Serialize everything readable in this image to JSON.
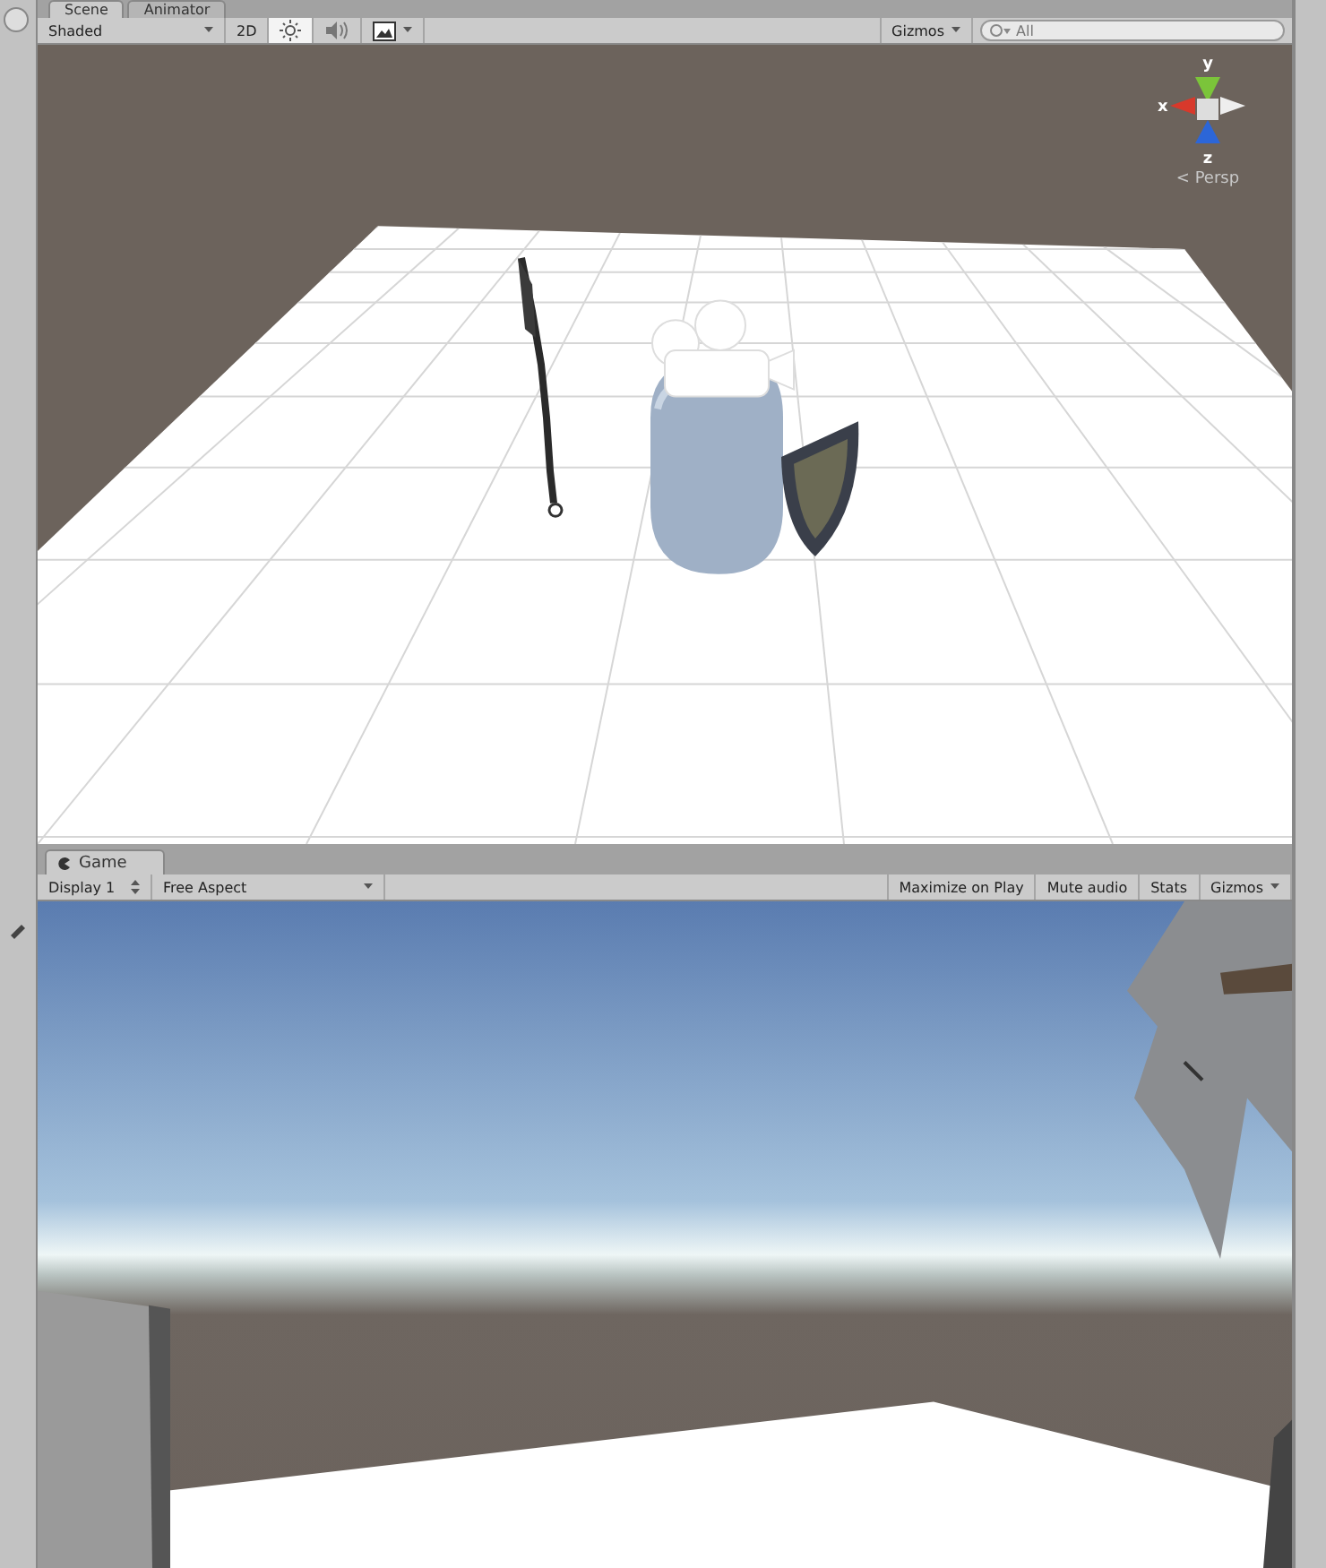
{
  "scene_panel": {
    "tabs": [
      {
        "label": "Scene",
        "selected": true
      },
      {
        "label": "Animator",
        "selected": false
      }
    ],
    "toolbar": {
      "draw_mode": "Shaded",
      "toggles": [
        {
          "kind": "text",
          "label": "2D",
          "on": false
        },
        {
          "kind": "lighting",
          "on": true
        },
        {
          "kind": "audio",
          "on": false
        },
        {
          "kind": "effects",
          "on": false
        }
      ],
      "gizmos": "Gizmos",
      "search": {
        "placeholder": "All"
      }
    },
    "orientation_gizmo": {
      "x_label": "x",
      "y_label": "y",
      "z_label": "z",
      "projection": "< Persp"
    }
  },
  "game_panel": {
    "tab": {
      "label": "Game"
    },
    "toolbar": {
      "display": "Display 1",
      "aspect": "Free Aspect",
      "toggles": [
        {
          "label": "Maximize on Play",
          "on": false
        },
        {
          "label": "Mute audio",
          "on": false
        },
        {
          "label": "Stats",
          "on": false
        }
      ],
      "gizmos": "Gizmos"
    }
  }
}
